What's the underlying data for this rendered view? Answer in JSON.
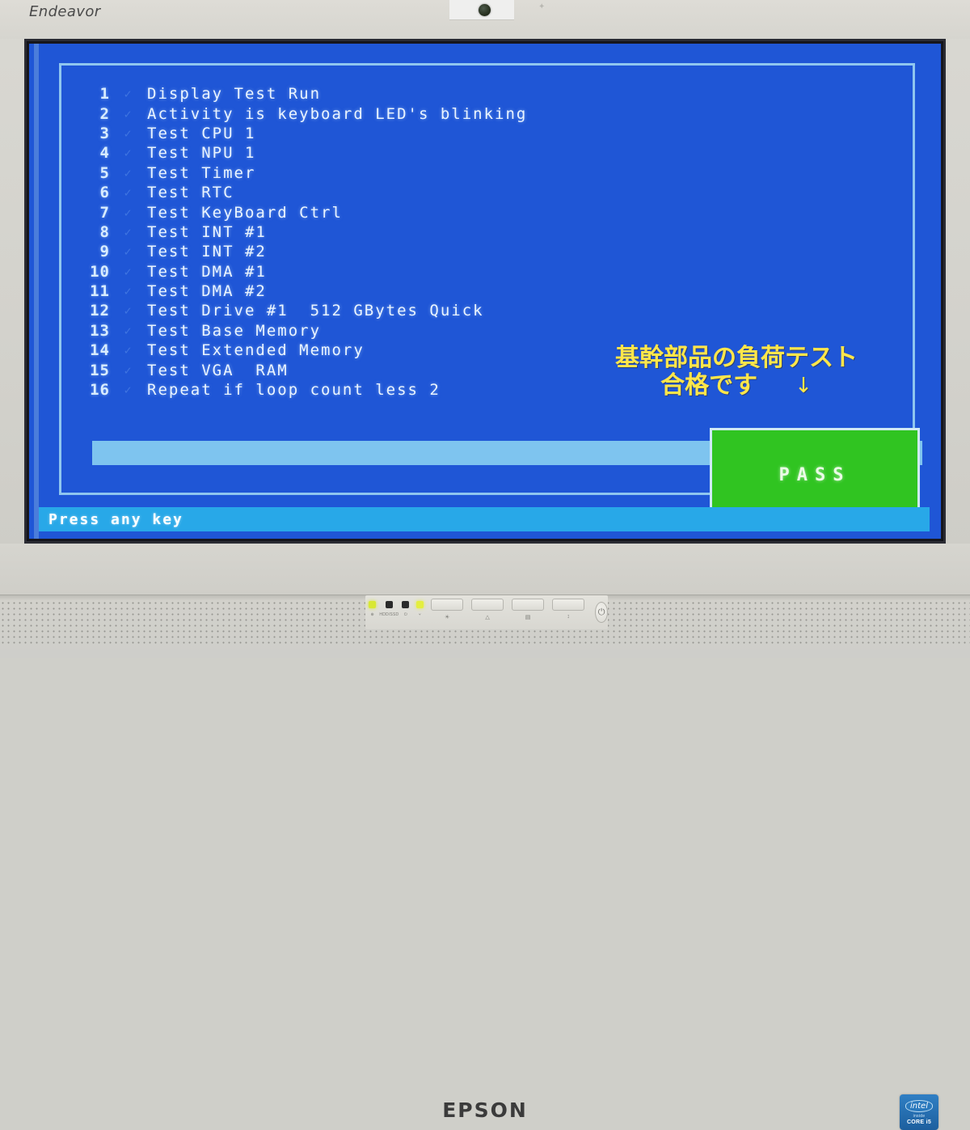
{
  "monitor": {
    "brand_left": "Endeavor",
    "brand_center": "EPSON",
    "webcam_icon": "webcam-lens-icon",
    "mic_icon": "microphone-icon",
    "intel_sticker": {
      "logo": "intel",
      "sub": "inside",
      "model": "CORE i5"
    }
  },
  "screen": {
    "background_color": "#1f56d6",
    "border_color": "#8fc6ef",
    "tests": [
      {
        "num": "1",
        "check": "✓",
        "name": "Display Test Run"
      },
      {
        "num": "2",
        "check": "✓",
        "name": "Activity is keyboard LED's blinking"
      },
      {
        "num": "3",
        "check": "✓",
        "name": "Test CPU 1"
      },
      {
        "num": "4",
        "check": "✓",
        "name": "Test NPU 1"
      },
      {
        "num": "5",
        "check": "✓",
        "name": "Test Timer"
      },
      {
        "num": "6",
        "check": "✓",
        "name": "Test RTC"
      },
      {
        "num": "7",
        "check": "✓",
        "name": "Test KeyBoard Ctrl"
      },
      {
        "num": "8",
        "check": "✓",
        "name": "Test INT #1"
      },
      {
        "num": "9",
        "check": "✓",
        "name": "Test INT #2"
      },
      {
        "num": "10",
        "check": "✓",
        "name": "Test DMA #1"
      },
      {
        "num": "11",
        "check": "✓",
        "name": "Test DMA #2"
      },
      {
        "num": "12",
        "check": "✓",
        "name": "Test Drive #1  512 GBytes Quick"
      },
      {
        "num": "13",
        "check": "✓",
        "name": "Test Base Memory"
      },
      {
        "num": "14",
        "check": "✓",
        "name": "Test Extended Memory"
      },
      {
        "num": "15",
        "check": "✓",
        "name": "Test VGA  RAM"
      },
      {
        "num": "16",
        "check": "✓",
        "name": "Repeat if loop count less 2"
      }
    ],
    "annotation": {
      "line1": "基幹部品の負荷テスト",
      "line2": "合格です",
      "arrow": "↓",
      "color": "#ffe64a"
    },
    "pass_box": {
      "label": "PASS",
      "color": "#30c421",
      "border_color": "#cfe9f6"
    },
    "progress_bar_color": "#7ec4ef",
    "status_bar": {
      "text": "Press any key",
      "color": "#28a8e8"
    }
  },
  "control_panel": {
    "leds": [
      {
        "name": "network-led",
        "label": "⊕",
        "color": "#d8e834",
        "state": "on"
      },
      {
        "name": "drive-led",
        "label": "HDD/SSD",
        "color": "#2b2b2b",
        "state": "off"
      },
      {
        "name": "power-led",
        "label": "⏻",
        "color": "#2b2b2b",
        "state": "off"
      },
      {
        "name": "wireless-led",
        "label": "⑂",
        "color": "#e4ee3f",
        "state": "on"
      }
    ],
    "buttons": [
      {
        "name": "brightness-button",
        "label": "☀"
      },
      {
        "name": "menu-button",
        "label": "△"
      },
      {
        "name": "input-button",
        "label": "▤"
      },
      {
        "name": "auto-button",
        "label": "↕"
      }
    ],
    "power_button": {
      "name": "power-button",
      "label": "⏻"
    }
  }
}
